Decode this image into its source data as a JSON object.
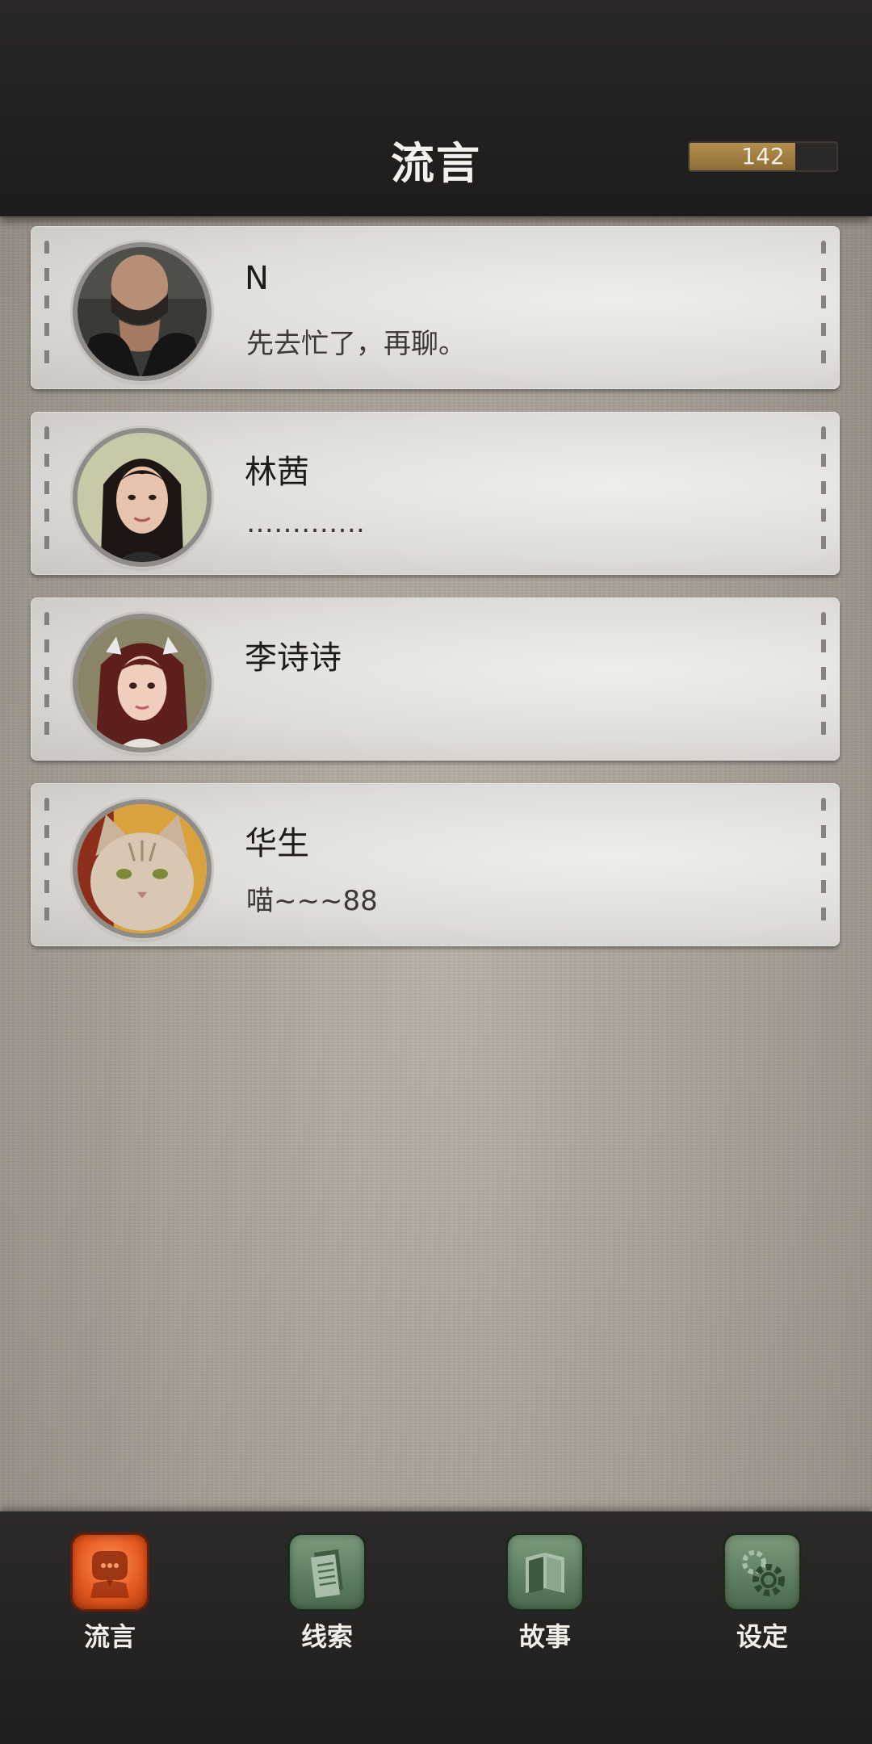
{
  "header": {
    "title": "流言",
    "currency": {
      "value": "142",
      "fill_fraction": 0.72
    }
  },
  "contacts": [
    {
      "name": "N",
      "message": "先去忙了，再聊。",
      "avatar": "man-avatar"
    },
    {
      "name": "林茜",
      "message": "………….",
      "avatar": "woman-avatar"
    },
    {
      "name": "李诗诗",
      "message": "",
      "avatar": "girl-avatar"
    },
    {
      "name": "华生",
      "message": "喵~~~88",
      "avatar": "cat-avatar"
    }
  ],
  "bottom_nav": {
    "tabs": [
      {
        "label": "流言",
        "icon": "chat-icon",
        "active": true
      },
      {
        "label": "线索",
        "icon": "clue-notes-icon",
        "active": false
      },
      {
        "label": "故事",
        "icon": "story-book-icon",
        "active": false
      },
      {
        "label": "设定",
        "icon": "settings-gear-icon",
        "active": false
      }
    ]
  },
  "colors": {
    "header_bg": "#1d1b1b",
    "active_tab": "#e2561e",
    "inactive_tab": "#5f7f60",
    "currency_fill": "#a07f42"
  }
}
